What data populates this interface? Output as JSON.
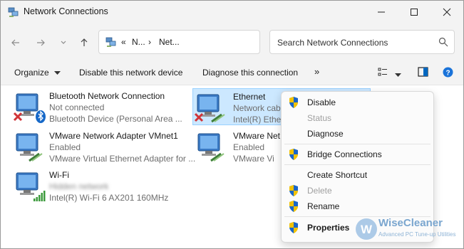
{
  "window": {
    "title": "Network Connections"
  },
  "address": {
    "crumbs": [
      "«",
      "N...",
      "›",
      "Net..."
    ]
  },
  "search": {
    "placeholder": "Search Network Connections"
  },
  "toolbar": {
    "organize": "Organize",
    "disable_device": "Disable this network device",
    "diagnose": "Diagnose this connection",
    "more": "»"
  },
  "connections": [
    {
      "name": "Bluetooth Network Connection",
      "status": "Not connected",
      "device": "Bluetooth Device (Personal Area ..."
    },
    {
      "name": "Ethernet",
      "status": "Network cab",
      "device": "Intel(R) Ether"
    },
    {
      "name": "VMware Network Adapter VMnet1",
      "status": "Enabled",
      "device": "VMware Virtual Ethernet Adapter for ..."
    },
    {
      "name": "VMware Net",
      "status": "Enabled",
      "device": "VMware Vi"
    },
    {
      "name": "Wi-Fi",
      "status": "Hidden network",
      "device": "Intel(R) Wi-Fi 6 AX201 160MHz"
    }
  ],
  "context_menu": [
    {
      "label": "Disable",
      "shield": true,
      "enabled": true,
      "bold": false
    },
    {
      "label": "Status",
      "shield": false,
      "enabled": false,
      "bold": false
    },
    {
      "label": "Diagnose",
      "shield": false,
      "enabled": true,
      "bold": false
    },
    {
      "label": "Bridge Connections",
      "shield": true,
      "enabled": true,
      "bold": false
    },
    {
      "label": "Create Shortcut",
      "shield": false,
      "enabled": true,
      "bold": false
    },
    {
      "label": "Delete",
      "shield": true,
      "enabled": false,
      "bold": false
    },
    {
      "label": "Rename",
      "shield": true,
      "enabled": true,
      "bold": false
    },
    {
      "label": "Properties",
      "shield": true,
      "enabled": true,
      "bold": true
    }
  ],
  "watermark": {
    "name": "WiseCleaner",
    "tagline": "Advanced PC Tune-up Utilities"
  },
  "colors": {
    "accent": "#0067c0",
    "selection": "#cce8ff",
    "error": "#d13438"
  }
}
